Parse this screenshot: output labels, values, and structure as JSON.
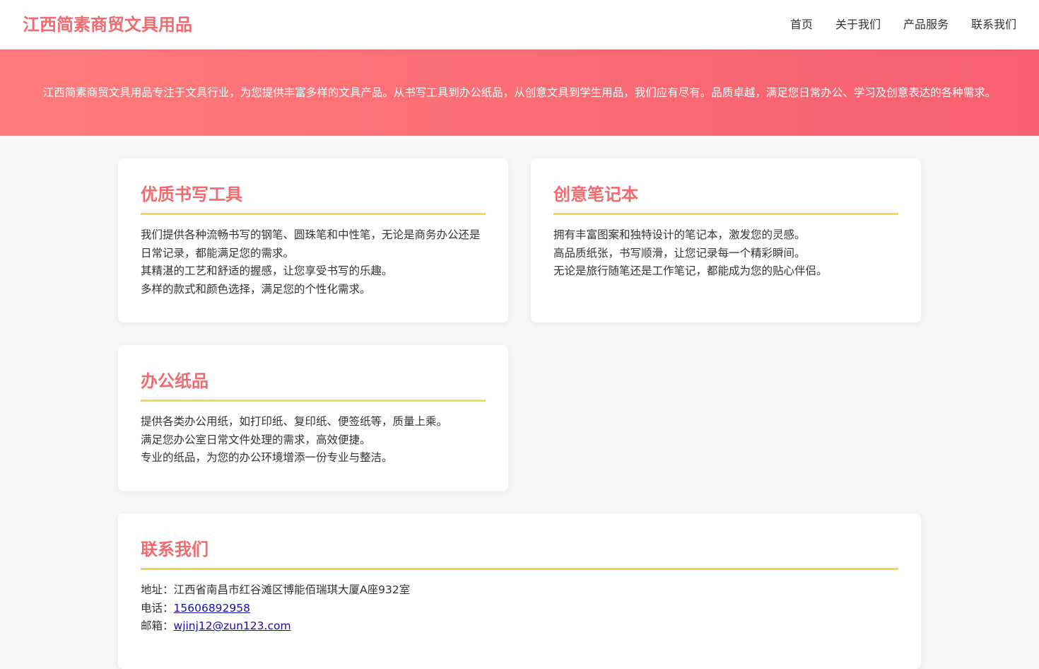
{
  "header": {
    "logo": "江西简素商贸文具用品",
    "nav": [
      "首页",
      "关于我们",
      "产品服务",
      "联系我们"
    ]
  },
  "hero": {
    "text": "江西简素商贸文具用品专注于文具行业，为您提供丰富多样的文具产品。从书写工具到办公纸品，从创意文具到学生用品，我们应有尽有。品质卓越，满足您日常办公、学习及创意表达的各种需求。"
  },
  "cards": [
    {
      "title": "优质书写工具",
      "lines": [
        "我们提供各种流畅书写的钢笔、圆珠笔和中性笔，无论是商务办公还是日常记录，都能满足您的需求。",
        "其精湛的工艺和舒适的握感，让您享受书写的乐趣。",
        "多样的款式和颜色选择，满足您的个性化需求。"
      ]
    },
    {
      "title": "创意笔记本",
      "lines": [
        "拥有丰富图案和独特设计的笔记本，激发您的灵感。",
        "高品质纸张，书写顺滑，让您记录每一个精彩瞬间。",
        "无论是旅行随笔还是工作笔记，都能成为您的贴心伴侣。"
      ]
    },
    {
      "title": "办公纸品",
      "lines": [
        "提供各类办公用纸，如打印纸、复印纸、便签纸等，质量上乘。",
        "满足您办公室日常文件处理的需求，高效便捷。",
        "专业的纸品，为您的办公环境增添一份专业与整洁。"
      ]
    }
  ],
  "contact": {
    "title": "联系我们",
    "address_label": "地址：",
    "address": "江西省南昌市红谷滩区博能佰瑞琪大厦A座932室",
    "phone_label": "电话：",
    "phone": "15606892958",
    "email_label": "邮箱：",
    "email": "wjinj12@zun123.com"
  },
  "colors": {
    "brand": "#f06b6f",
    "hero_start": "#ff7b7b",
    "hero_end": "#f65f6f",
    "accent_rule": "#f2d65a",
    "link": "#1a0dab"
  }
}
